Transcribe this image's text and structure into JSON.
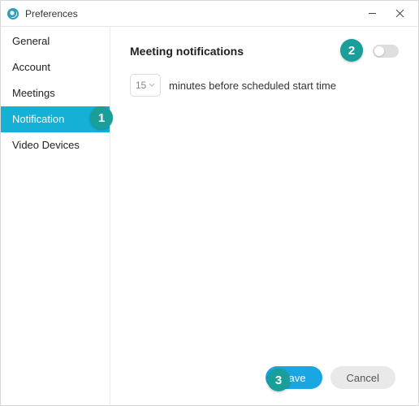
{
  "window": {
    "title": "Preferences"
  },
  "sidebar": {
    "items": [
      {
        "label": "General"
      },
      {
        "label": "Account"
      },
      {
        "label": "Meetings"
      },
      {
        "label": "Notification"
      },
      {
        "label": "Video Devices"
      }
    ],
    "selected_index": 3
  },
  "panel": {
    "title": "Meeting notifications",
    "toggle_on": false,
    "minutes_value": "15",
    "minutes_label": "minutes before scheduled start time"
  },
  "footer": {
    "save_label": "Save",
    "cancel_label": "Cancel"
  },
  "annotations": {
    "badge1": "1",
    "badge2": "2",
    "badge3": "3"
  },
  "colors": {
    "accent": "#15b0d6",
    "badge": "#199e9a",
    "primary_button": "#1aa6e2"
  }
}
